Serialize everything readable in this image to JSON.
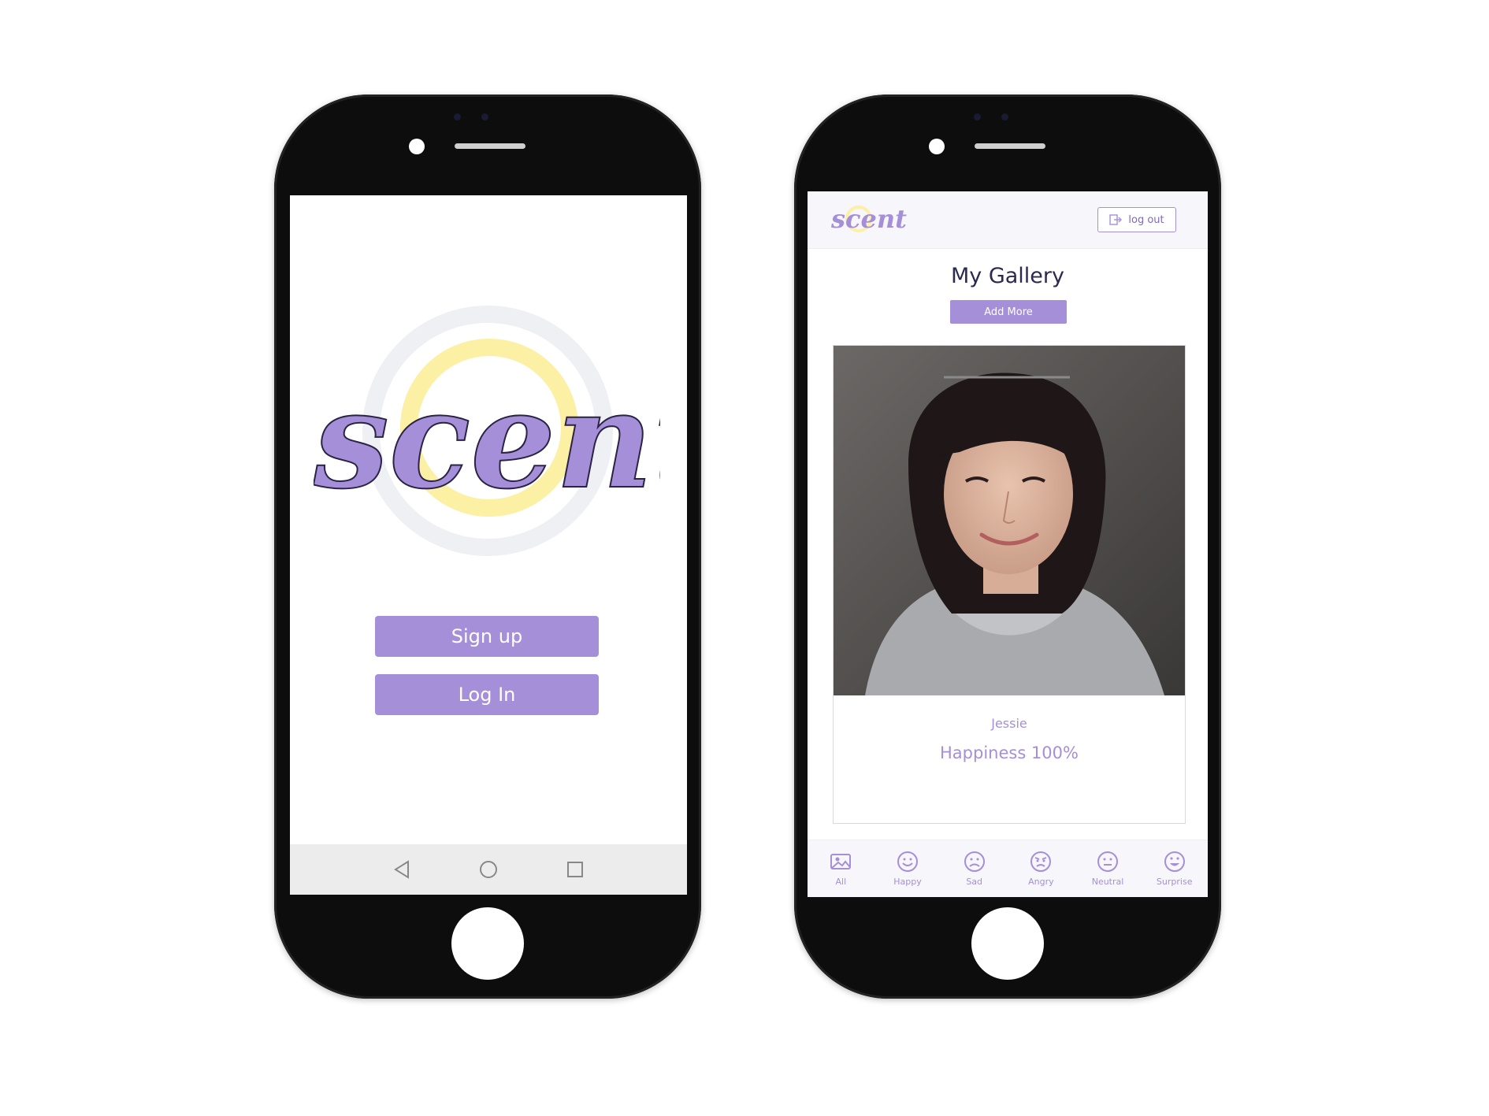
{
  "colors": {
    "accent": "#a58fd8",
    "ring_yellow": "#fbf0a4",
    "ring_gray": "#eef0f3",
    "title_dark": "#2b2950"
  },
  "left_screen": {
    "logo_text": "scent",
    "signup_label": "Sign up",
    "login_label": "Log In",
    "android_nav": [
      "back-icon",
      "home-circle-icon",
      "recents-square-icon"
    ]
  },
  "right_screen": {
    "header": {
      "logo_text": "scent",
      "logout_label": "log out",
      "logout_icon": "logout-icon"
    },
    "gallery_title": "My Gallery",
    "add_more_label": "Add More",
    "card": {
      "name": "Jessie",
      "emotion": "Happiness 100%"
    },
    "tabs": [
      {
        "label": "All",
        "icon": "gallery-icon"
      },
      {
        "label": "Happy",
        "icon": "happy-face-icon"
      },
      {
        "label": "Sad",
        "icon": "sad-face-icon"
      },
      {
        "label": "Angry",
        "icon": "angry-face-icon"
      },
      {
        "label": "Neutral",
        "icon": "neutral-face-icon"
      },
      {
        "label": "Surprise",
        "icon": "surprise-face-icon"
      }
    ]
  }
}
